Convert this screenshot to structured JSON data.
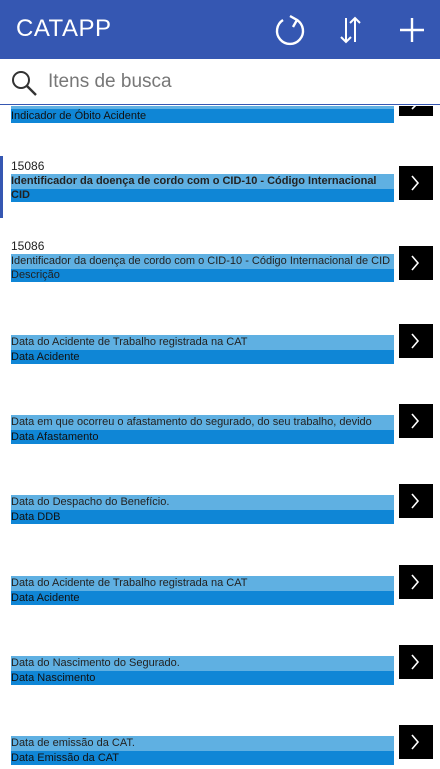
{
  "header": {
    "title": "CATAPP",
    "refresh_icon": "refresh-icon",
    "sort_icon": "sort-icon",
    "add_icon": "plus-icon"
  },
  "search": {
    "placeholder": "Itens de busca",
    "value": ""
  },
  "list": {
    "items": [
      {
        "id": "",
        "title": "",
        "subtitle": "Indicador de Óbito Acidente"
      },
      {
        "id": "15086",
        "title": "Identificador da doença de cordo com o CID-10 - Código Internacional CID",
        "subtitle": "",
        "selected": true
      },
      {
        "id": "15086",
        "title": "Identificador da doença de cordo com o CID-10 - Código Internacional de CID Descrição",
        "subtitle": ""
      },
      {
        "id": "",
        "title": "Data do Acidente de Trabalho registrada na CAT",
        "subtitle": "Data Acidente"
      },
      {
        "id": "",
        "title": "Data em que ocorreu o afastamento do segurado, do seu trabalho, devido",
        "subtitle": "Data Afastamento"
      },
      {
        "id": "",
        "title": "Data do Despacho do Benefício.",
        "subtitle": "Data DDB"
      },
      {
        "id": "",
        "title": "Data do Acidente de Trabalho registrada na CAT",
        "subtitle": "Data Acidente"
      },
      {
        "id": "",
        "title": "Data do Nascimento do Segurado.",
        "subtitle": "Data Nascimento"
      },
      {
        "id": "",
        "title": "Data de emissão da CAT.",
        "subtitle": "Data Emissão da CAT"
      }
    ]
  },
  "colors": {
    "header": "#3557b2",
    "title_bar": "#5fb0e2",
    "subtitle_bar": "#0f86d6"
  }
}
